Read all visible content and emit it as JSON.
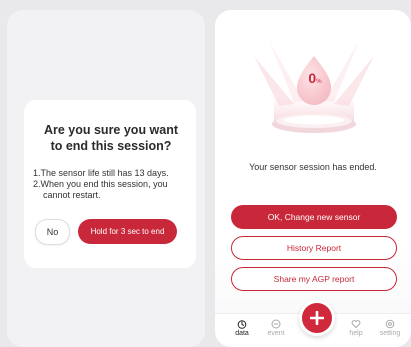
{
  "dialog": {
    "title": "Are you sure you want to end this session?",
    "line1": "1.The sensor life still has 13 days.",
    "line2a": "2.When you end this session, you",
    "line2b": "cannot restart.",
    "no_label": "No",
    "end_label": "Hold for 3 sec to end"
  },
  "sensor": {
    "percent_value": "0",
    "percent_unit": "%",
    "session_message": "Your sensor session has ended."
  },
  "actions": {
    "change_label": "OK, Change new sensor",
    "history_label": "History Report",
    "agp_label": "Share my AGP report"
  },
  "tabbar": {
    "tabs": [
      {
        "label": "data",
        "icon": "data-icon"
      },
      {
        "label": "event",
        "icon": "event-icon"
      },
      {
        "label": "help",
        "icon": "help-icon"
      },
      {
        "label": "setting",
        "icon": "setting-icon"
      }
    ],
    "fab_icon": "plus-icon"
  },
  "colors": {
    "accent": "#c8283a",
    "background": "#e9e9ec"
  }
}
